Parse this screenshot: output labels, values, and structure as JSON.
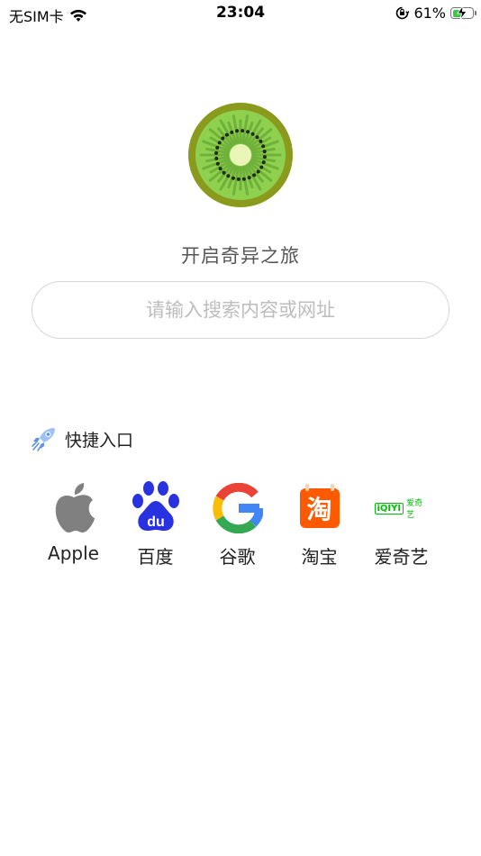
{
  "status_bar": {
    "carrier": "无SIM卡",
    "time": "23:04",
    "battery_percent": "61%",
    "battery_level": 0.61,
    "icons": [
      "wifi-icon",
      "orientation-lock-icon",
      "battery-charging-icon"
    ]
  },
  "hero": {
    "logo": "kiwi-logo",
    "tagline": "开启奇异之旅"
  },
  "search": {
    "placeholder": "请输入搜索内容或网址",
    "value": ""
  },
  "quick_links": {
    "icon": "rocket-icon",
    "title": "快捷入口",
    "items": [
      {
        "label": "Apple",
        "icon": "apple-icon"
      },
      {
        "label": "百度",
        "icon": "baidu-icon",
        "logo_text": "du"
      },
      {
        "label": "谷歌",
        "icon": "google-icon"
      },
      {
        "label": "淘宝",
        "icon": "taobao-icon",
        "logo_text": "淘"
      },
      {
        "label": "爱奇艺",
        "icon": "iqiyi-icon",
        "logo_text": "iQIYI",
        "logo_subtext": "爱奇艺"
      }
    ]
  },
  "colors": {
    "kiwi_rim": "#8a9a1c",
    "kiwi_flesh": "#8fd14f",
    "taobao": "#ff5a00",
    "iqiyi": "#00be06",
    "baidu": "#2932e1",
    "battery_fill": "#3cc64a"
  }
}
